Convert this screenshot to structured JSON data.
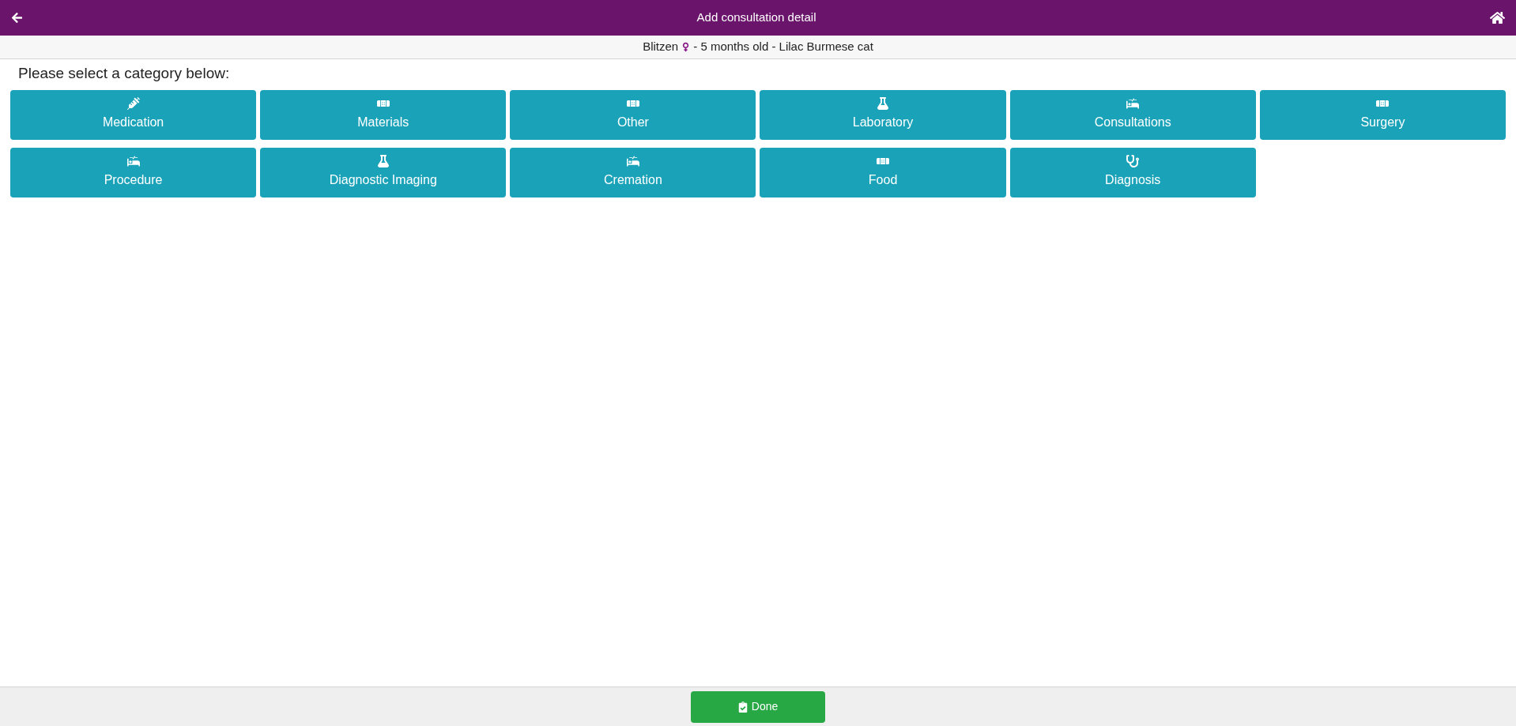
{
  "header": {
    "title": "Add consultation detail"
  },
  "patient": {
    "name": "Blitzen",
    "details": "- 5 months old - Lilac Burmese cat"
  },
  "prompt": "Please select a category below:",
  "categories": [
    {
      "label": "Medication",
      "kind": "syringe"
    },
    {
      "label": "Materials",
      "kind": "bandage"
    },
    {
      "label": "Other",
      "kind": "bandage"
    },
    {
      "label": "Laboratory",
      "kind": "flask"
    },
    {
      "label": "Consultations",
      "kind": "bed"
    },
    {
      "label": "Surgery",
      "kind": "bandage"
    },
    {
      "label": "Procedure",
      "kind": "bed"
    },
    {
      "label": "Diagnostic Imaging",
      "kind": "flask"
    },
    {
      "label": "Cremation",
      "kind": "bed"
    },
    {
      "label": "Food",
      "kind": "bandage"
    },
    {
      "label": "Diagnosis",
      "kind": "stethoscope"
    }
  ],
  "footer": {
    "done": "Done"
  }
}
